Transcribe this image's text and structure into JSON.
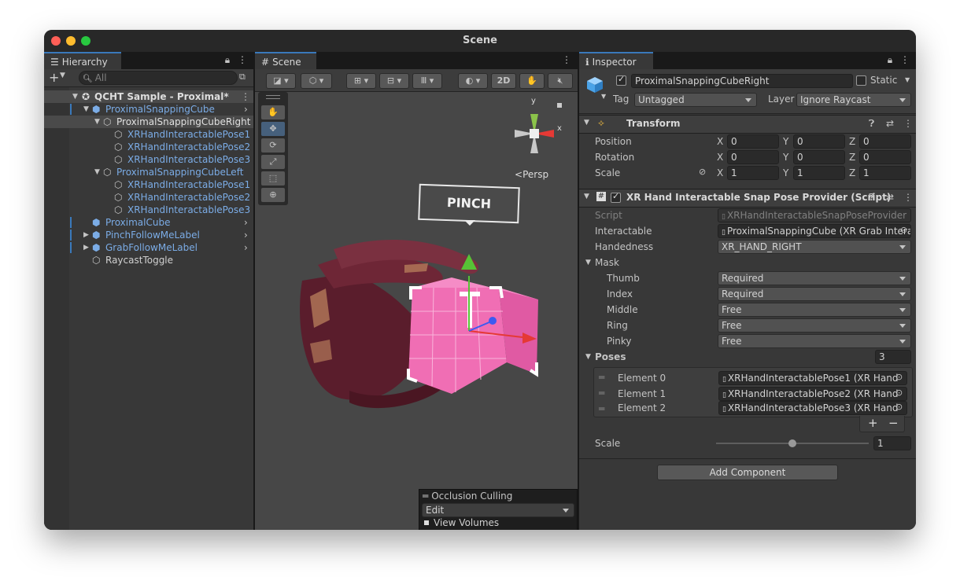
{
  "window": {
    "title": "Scene"
  },
  "hierarchy": {
    "tab_label": "Hierarchy",
    "search_placeholder": "All",
    "items": [
      {
        "label": "QCHT Sample - Proximal*"
      },
      {
        "label": "ProximalSnappingCube"
      },
      {
        "label": "ProximalSnappingCubeRight"
      },
      {
        "label": "XRHandInteractablePose1"
      },
      {
        "label": "XRHandInteractablePose2"
      },
      {
        "label": "XRHandInteractablePose3"
      },
      {
        "label": "ProximalSnappingCubeLeft"
      },
      {
        "label": "XRHandInteractablePose1"
      },
      {
        "label": "XRHandInteractablePose2"
      },
      {
        "label": "XRHandInteractablePose3"
      },
      {
        "label": "ProximalCube"
      },
      {
        "label": "PinchFollowMeLabel"
      },
      {
        "label": "GrabFollowMeLabel"
      },
      {
        "label": "RaycastToggle"
      }
    ]
  },
  "scene": {
    "tab_label": "Scene",
    "mode_2d": "2D",
    "persp_label": "Persp",
    "gizmo_y": "y",
    "gizmo_x": "x",
    "pinch_label": "PINCH",
    "occlusion": {
      "title": "Occlusion Culling",
      "mode": "Edit",
      "view_volumes": "View Volumes"
    }
  },
  "inspector": {
    "tab_label": "Inspector",
    "object_name": "ProximalSnappingCubeRight",
    "static_label": "Static",
    "tag_label": "Tag",
    "tag_value": "Untagged",
    "layer_label": "Layer",
    "layer_value": "Ignore Raycast",
    "transform": {
      "title": "Transform",
      "position_label": "Position",
      "rotation_label": "Rotation",
      "scale_label": "Scale",
      "axis_x": "X",
      "axis_y": "Y",
      "axis_z": "Z",
      "position": [
        "0",
        "0",
        "0"
      ],
      "rotation": [
        "0",
        "0",
        "0"
      ],
      "scale": [
        "1",
        "1",
        "1"
      ]
    },
    "script_component": {
      "title": "XR Hand Interactable Snap Pose Provider (Script)",
      "script_label": "Script",
      "script_value": "XRHandInteractableSnapPoseProvider",
      "interactable_label": "Interactable",
      "interactable_value": "ProximalSnappingCube (XR Grab Intera",
      "handedness_label": "Handedness",
      "handedness_value": "XR_HAND_RIGHT",
      "mask_label": "Mask",
      "mask": [
        {
          "label": "Thumb",
          "value": "Required"
        },
        {
          "label": "Index",
          "value": "Required"
        },
        {
          "label": "Middle",
          "value": "Free"
        },
        {
          "label": "Ring",
          "value": "Free"
        },
        {
          "label": "Pinky",
          "value": "Free"
        }
      ],
      "poses_label": "Poses",
      "poses_count": "3",
      "poses": [
        {
          "label": "Element 0",
          "value": "XRHandInteractablePose1 (XR Hand"
        },
        {
          "label": "Element 1",
          "value": "XRHandInteractablePose2 (XR Hand"
        },
        {
          "label": "Element 2",
          "value": "XRHandInteractablePose3 (XR Hand"
        }
      ],
      "add_label": "+",
      "remove_label": "−",
      "scale_label": "Scale",
      "scale_value": "1",
      "scale_slider_fraction": 0.5
    },
    "add_component_label": "Add Component"
  },
  "colors": {
    "accent": "#3a79bb",
    "prefab_blue": "#7bace6",
    "cube_pink": "#f06eb4",
    "hand_maroon": "#5a1d2c"
  }
}
